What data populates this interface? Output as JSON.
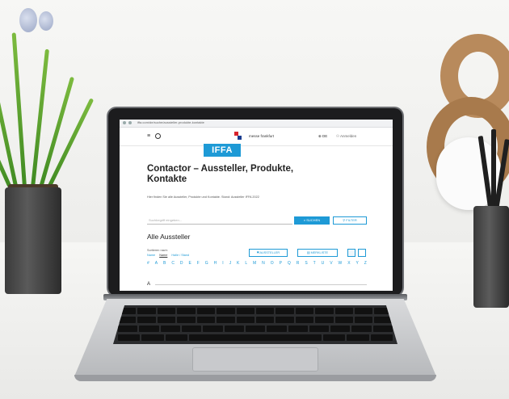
{
  "browser": {
    "address": "iffa.com/de/suche/aussteller-produkte-kontakte"
  },
  "nav": {
    "menu_icon": "hamburger-icon",
    "brand": "messe frankfurt",
    "language": "DE",
    "user": "Anmelden"
  },
  "logo": {
    "text": "IFFA"
  },
  "page": {
    "title": "Contactor – Aussteller, Produkte, Kontakte",
    "subtitle": "Hier finden Sie alle Aussteller, Produkte und Kontakte. Stand: Aussteller IFFA 2022",
    "search_placeholder": "Suchbegriff eingeben...",
    "search_button": "SUCHEN",
    "filter_button": "FILTER",
    "list_heading": "Alle Aussteller",
    "sort_label": "Sortieren nach:",
    "sort_options": [
      "Name",
      "Name",
      "Halle / Stand"
    ],
    "map_button": "AUSSTELLER",
    "list_button": "MERKLISTE",
    "alphabet": [
      "#",
      "A",
      "B",
      "C",
      "D",
      "E",
      "F",
      "G",
      "H",
      "I",
      "J",
      "K",
      "L",
      "M",
      "N",
      "O",
      "P",
      "Q",
      "R",
      "S",
      "T",
      "U",
      "V",
      "W",
      "X",
      "Y",
      "Z"
    ],
    "section_letter": "A"
  },
  "colors": {
    "accent": "#1e9ad6",
    "brand_red": "#d9232d",
    "brand_blue": "#1a3c8f"
  }
}
